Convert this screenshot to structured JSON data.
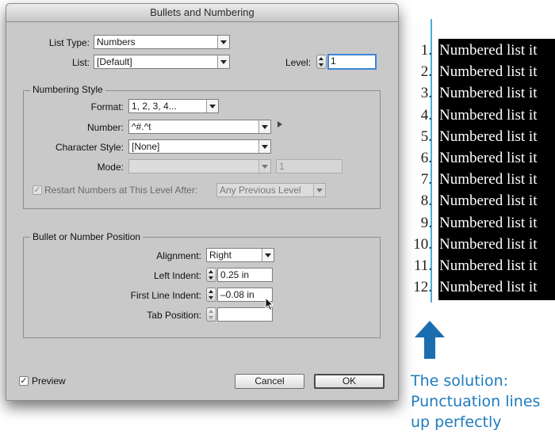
{
  "dialog": {
    "title": "Bullets and Numbering",
    "list_type_label": "List Type:",
    "list_type_value": "Numbers",
    "list_label": "List:",
    "list_value": "[Default]",
    "level_label": "Level:",
    "level_value": "1",
    "numbering_style": {
      "legend": "Numbering Style",
      "format_label": "Format:",
      "format_value": "1, 2, 3, 4...",
      "number_label": "Number:",
      "number_value": "^#.^t",
      "char_style_label": "Character Style:",
      "char_style_value": "[None]",
      "mode_label": "Mode:",
      "mode_value": "",
      "mode_number": "1",
      "restart_label": "Restart Numbers at This Level After:",
      "restart_checked": true,
      "restart_value": "Any Previous Level"
    },
    "position": {
      "legend": "Bullet or Number Position",
      "alignment_label": "Alignment:",
      "alignment_value": "Right",
      "left_indent_label": "Left Indent:",
      "left_indent_value": "0.25 in",
      "first_line_label": "First Line Indent:",
      "first_line_value": "–0.08 in",
      "tab_label": "Tab Position:",
      "tab_value": ""
    },
    "preview_label": "Preview",
    "preview_checked": true,
    "cancel_label": "Cancel",
    "ok_label": "OK"
  },
  "list_sample": {
    "numbers": [
      "1.",
      "2.",
      "3.",
      "4.",
      "5.",
      "6.",
      "7.",
      "8.",
      "9.",
      "10.",
      "11.",
      "12."
    ],
    "item_text": "Numbered list it"
  },
  "annotation": {
    "line1": "The solution:",
    "line2": "Punctuation lines",
    "line3": "up perfectly"
  },
  "colors": {
    "guide_line": "#4aaed8",
    "arrow": "#1a6eb0",
    "annotation_text": "#1e7bbd",
    "list_background": "#000000"
  }
}
